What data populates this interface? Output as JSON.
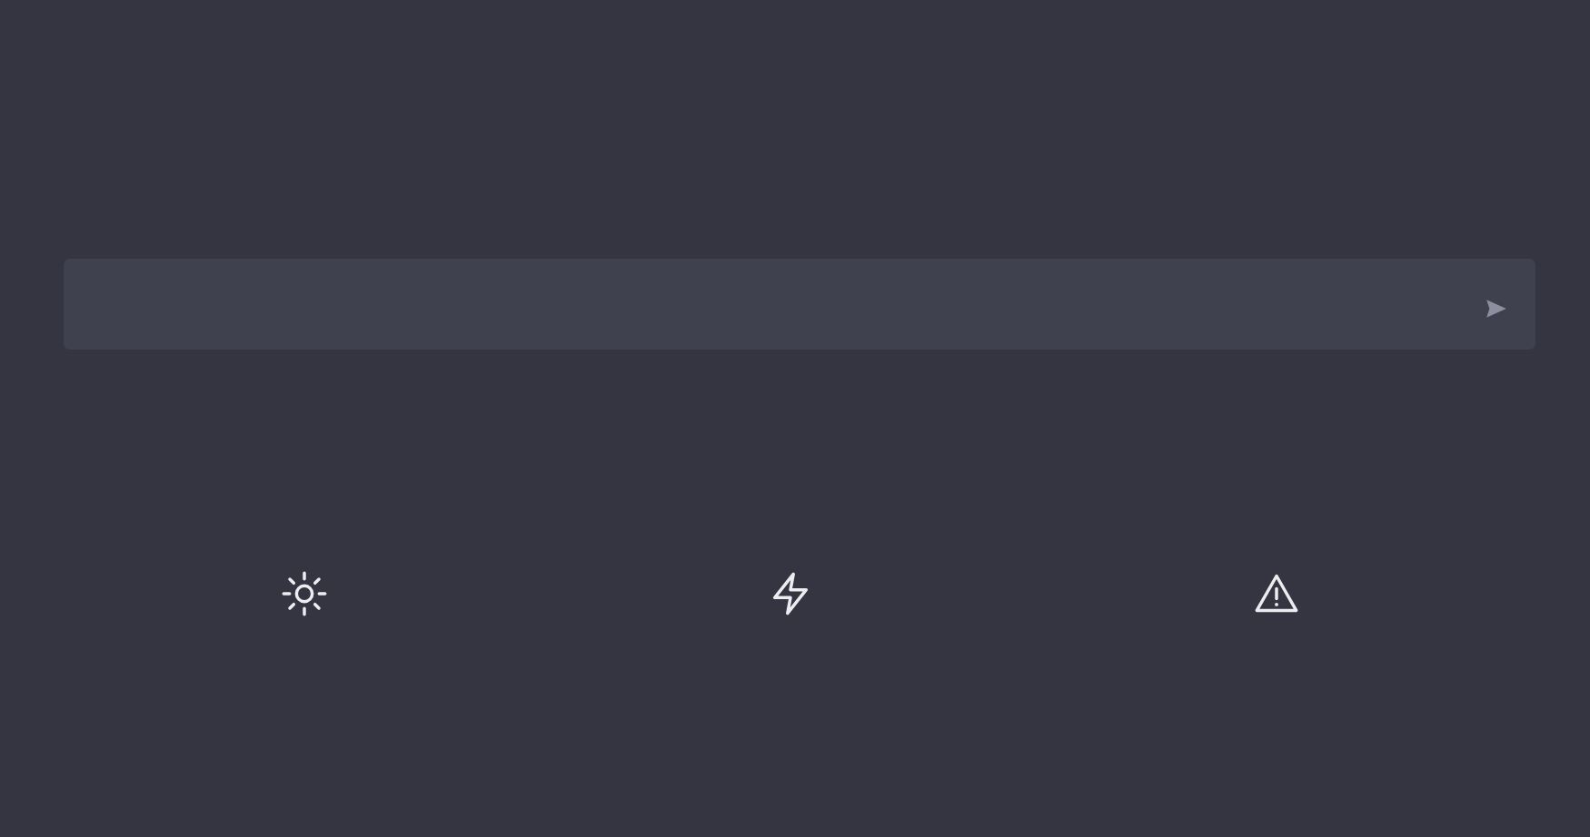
{
  "message_field": {
    "send_button": {
      "disabled": true
    }
  },
  "feature_icons": [
    {
      "kind": "sun"
    },
    {
      "kind": "bolt"
    },
    {
      "kind": "warning"
    }
  ]
}
